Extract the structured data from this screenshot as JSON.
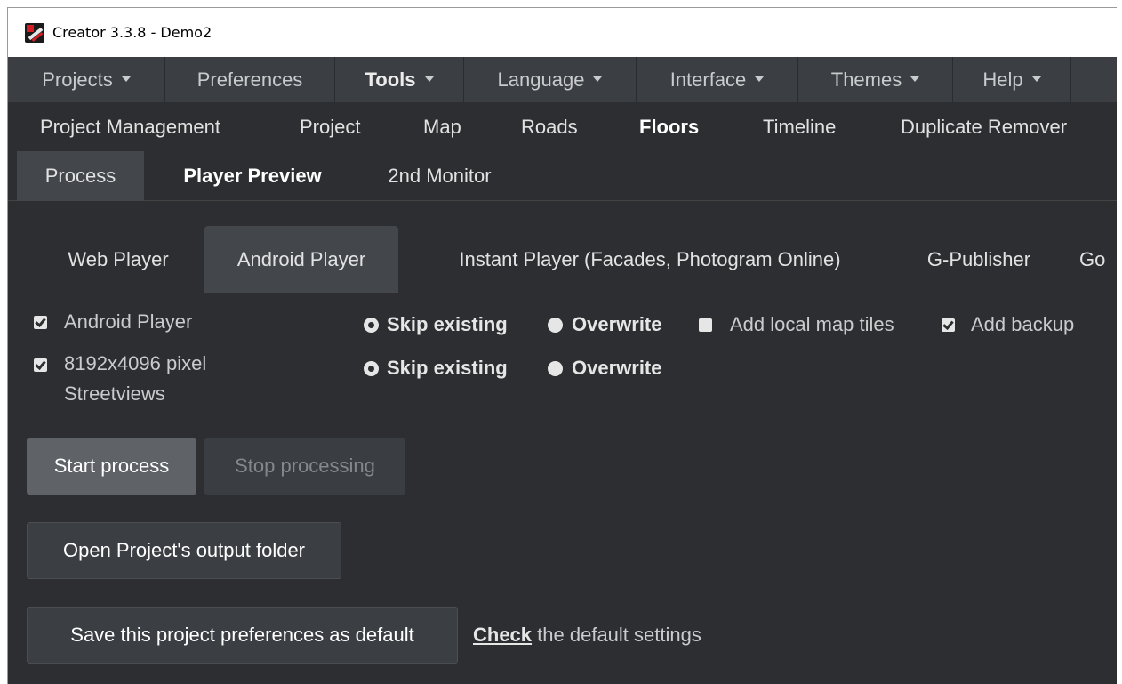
{
  "window": {
    "title": "Creator 3.3.8 - Demo2"
  },
  "menubar": {
    "items": [
      {
        "label": "Projects",
        "caret": true
      },
      {
        "label": "Preferences",
        "caret": false
      },
      {
        "label": "Tools",
        "caret": true
      },
      {
        "label": "Language",
        "caret": true
      },
      {
        "label": "Interface",
        "caret": true
      },
      {
        "label": "Themes",
        "caret": true
      },
      {
        "label": "Help",
        "caret": true
      }
    ]
  },
  "subnav": {
    "items": [
      "Project Management",
      "Project",
      "Map",
      "Roads",
      "Floors",
      "Timeline",
      "Duplicate Remover"
    ]
  },
  "tabs2": {
    "items": [
      "Process",
      "Player Preview",
      "2nd Monitor"
    ]
  },
  "tabs3": {
    "items": [
      "Web Player",
      "Android Player",
      "Instant Player (Facades, Photogram Online)",
      "G-Publisher",
      "Go"
    ]
  },
  "options": {
    "android_player": {
      "label": "Android Player",
      "checked": true
    },
    "streetviews": {
      "label_line1": "8192x4096 pixel",
      "label_line2": "Streetviews",
      "checked": true
    },
    "skip_existing": "Skip existing",
    "overwrite": "Overwrite",
    "add_local_map_tiles": {
      "label": "Add local map tiles",
      "checked": false
    },
    "add_backup": {
      "label": "Add backup",
      "checked": true
    }
  },
  "buttons": {
    "start": "Start process",
    "stop": "Stop processing",
    "open_folder": "Open Project's output folder",
    "save_default": "Save this project preferences as default"
  },
  "check_line": {
    "link": "Check",
    "rest": " the default settings"
  }
}
